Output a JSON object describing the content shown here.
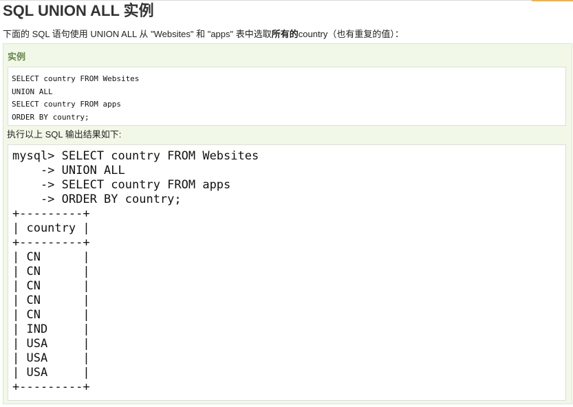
{
  "title": "SQL UNION ALL 实例",
  "intro": {
    "prefix": "下面的 SQL 语句使用 UNION ALL 从 \"Websites\" 和 \"apps\" 表中选取",
    "bold": "所有的",
    "suffix": "country（也有重复的值）："
  },
  "example": {
    "label": "实例",
    "code_lines": [
      "SELECT country FROM Websites",
      "UNION ALL",
      "SELECT country FROM apps",
      "ORDER BY country;"
    ],
    "result_label": "执行以上 SQL 输出结果如下:",
    "output_lines": [
      "mysql> SELECT country FROM Websites",
      "    -> UNION ALL",
      "    -> SELECT country FROM apps",
      "    -> ORDER BY country;",
      "+---------+",
      "| country |",
      "+---------+",
      "| CN      |",
      "| CN      |",
      "| CN      |",
      "| CN      |",
      "| CN      |",
      "| IND     |",
      "| USA     |",
      "| USA     |",
      "| USA     |",
      "+---------+"
    ]
  }
}
